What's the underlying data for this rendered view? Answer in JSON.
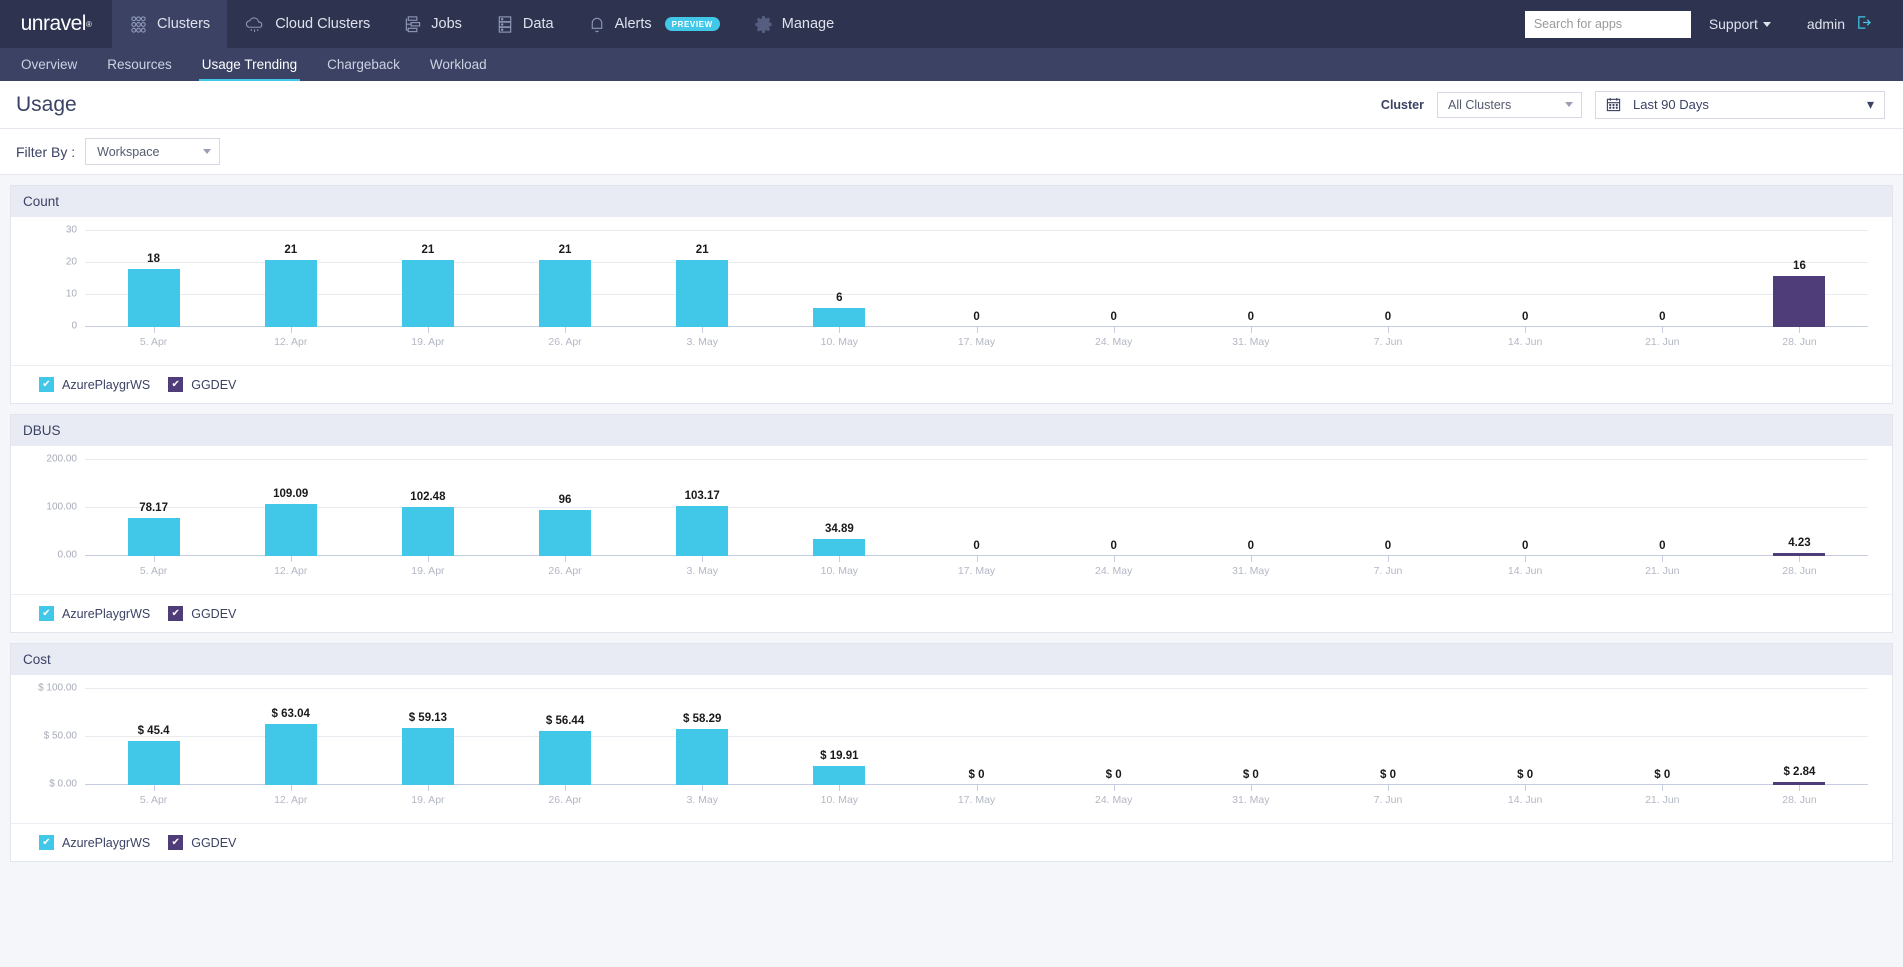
{
  "topnav": {
    "brand": "unravel",
    "brand_tm": "®",
    "items": [
      {
        "label": "Clusters",
        "icon": "clusters-icon",
        "active": true
      },
      {
        "label": "Cloud Clusters",
        "icon": "cloud-icon",
        "active": false
      },
      {
        "label": "Jobs",
        "icon": "jobs-icon",
        "active": false
      },
      {
        "label": "Data",
        "icon": "database-icon",
        "active": false
      },
      {
        "label": "Alerts",
        "icon": "bell-icon",
        "active": false,
        "badge": "PREVIEW"
      },
      {
        "label": "Manage",
        "icon": "gear-icon",
        "active": false
      }
    ],
    "search_placeholder": "Search for apps",
    "search_value": "",
    "support_label": "Support",
    "user_label": "admin"
  },
  "subnav": {
    "items": [
      {
        "label": "Overview",
        "active": false
      },
      {
        "label": "Resources",
        "active": false
      },
      {
        "label": "Usage Trending",
        "active": true
      },
      {
        "label": "Chargeback",
        "active": false
      },
      {
        "label": "Workload",
        "active": false
      }
    ]
  },
  "page": {
    "title": "Usage",
    "cluster_label": "Cluster",
    "cluster_value": "All Clusters",
    "date_value": "Last 90 Days",
    "filter_label": "Filter By :",
    "workspace_value": "Workspace"
  },
  "legend": {
    "items": [
      {
        "label": "AzurePlaygrWS",
        "color": "#41c7e8",
        "checked": true
      },
      {
        "label": "GGDEV",
        "color": "#4f3d7a",
        "checked": true
      }
    ]
  },
  "colors": {
    "series_primary": "#41c7e8",
    "series_secondary": "#4f3d7a",
    "accent": "#41c7e8",
    "navy": "#2e3450",
    "subnav": "#3b4264"
  },
  "panels": [
    {
      "title": "Count"
    },
    {
      "title": "DBUS"
    },
    {
      "title": "Cost"
    }
  ],
  "chart_data": [
    {
      "type": "bar",
      "title": "Count",
      "xlabel": "",
      "ylabel": "",
      "ylim": [
        0,
        30
      ],
      "yticks": [
        "0",
        "10",
        "20",
        "30"
      ],
      "ytick_values": [
        0,
        10,
        20,
        30
      ],
      "grid": true,
      "legend_position": "bottom",
      "categories": [
        "5. Apr",
        "12. Apr",
        "19. Apr",
        "26. Apr",
        "3. May",
        "10. May",
        "17. May",
        "24. May",
        "31. May",
        "7. Jun",
        "14. Jun",
        "21. Jun",
        "28. Jun"
      ],
      "series": [
        {
          "name": "AzurePlaygrWS",
          "color": "#41c7e8",
          "values": [
            18,
            21,
            21,
            21,
            21,
            6,
            0,
            0,
            0,
            0,
            0,
            0,
            0
          ]
        },
        {
          "name": "GGDEV",
          "color": "#4f3d7a",
          "values": [
            0,
            0,
            0,
            0,
            0,
            0,
            0,
            0,
            0,
            0,
            0,
            0,
            16
          ]
        }
      ],
      "labels": [
        "18",
        "21",
        "21",
        "21",
        "21",
        "6",
        "0",
        "0",
        "0",
        "0",
        "0",
        "0",
        "16"
      ]
    },
    {
      "type": "bar",
      "title": "DBUS",
      "xlabel": "",
      "ylabel": "",
      "ylim": [
        0,
        200
      ],
      "yticks": [
        "0.00",
        "100.00",
        "200.00"
      ],
      "ytick_values": [
        0,
        100,
        200
      ],
      "grid": true,
      "legend_position": "bottom",
      "categories": [
        "5. Apr",
        "12. Apr",
        "19. Apr",
        "26. Apr",
        "3. May",
        "10. May",
        "17. May",
        "24. May",
        "31. May",
        "7. Jun",
        "14. Jun",
        "21. Jun",
        "28. Jun"
      ],
      "series": [
        {
          "name": "AzurePlaygrWS",
          "color": "#41c7e8",
          "values": [
            78.17,
            109.09,
            102.48,
            96,
            103.17,
            34.89,
            0,
            0,
            0,
            0,
            0,
            0,
            0
          ]
        },
        {
          "name": "GGDEV",
          "color": "#4f3d7a",
          "values": [
            0,
            0,
            0,
            0,
            0,
            0,
            0,
            0,
            0,
            0,
            0,
            0,
            4.23
          ]
        }
      ],
      "labels": [
        "78.17",
        "109.09",
        "102.48",
        "96",
        "103.17",
        "34.89",
        "0",
        "0",
        "0",
        "0",
        "0",
        "0",
        "4.23"
      ]
    },
    {
      "type": "bar",
      "title": "Cost",
      "xlabel": "",
      "ylabel": "",
      "ylim": [
        0,
        100
      ],
      "yticks": [
        "$ 0.00",
        "$ 50.00",
        "$ 100.00"
      ],
      "ytick_values": [
        0,
        50,
        100
      ],
      "grid": true,
      "legend_position": "bottom",
      "categories": [
        "5. Apr",
        "12. Apr",
        "19. Apr",
        "26. Apr",
        "3. May",
        "10. May",
        "17. May",
        "24. May",
        "31. May",
        "7. Jun",
        "14. Jun",
        "21. Jun",
        "28. Jun"
      ],
      "series": [
        {
          "name": "AzurePlaygrWS",
          "color": "#41c7e8",
          "values": [
            45.4,
            63.04,
            59.13,
            56.44,
            58.29,
            19.91,
            0,
            0,
            0,
            0,
            0,
            0,
            0
          ]
        },
        {
          "name": "GGDEV",
          "color": "#4f3d7a",
          "values": [
            0,
            0,
            0,
            0,
            0,
            0,
            0,
            0,
            0,
            0,
            0,
            0,
            2.84
          ]
        }
      ],
      "labels": [
        "$ 45.4",
        "$ 63.04",
        "$ 59.13",
        "$ 56.44",
        "$ 58.29",
        "$ 19.91",
        "$ 0",
        "$ 0",
        "$ 0",
        "$ 0",
        "$ 0",
        "$ 0",
        "$ 2.84"
      ]
    }
  ]
}
